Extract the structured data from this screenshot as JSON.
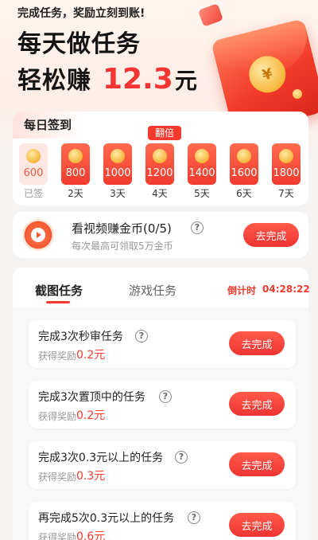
{
  "hero": {
    "subtitle": "完成任务，奖励立刻到账!",
    "line1": "每天做任务",
    "line2_prefix": "轻松赚",
    "amount": "12.3",
    "unit": "元",
    "seal_glyph": "¥"
  },
  "checkin": {
    "title": "每日签到",
    "double_badge": "翻倍",
    "days": [
      {
        "value": "600",
        "label": "已签",
        "done": true
      },
      {
        "value": "800",
        "label": "2天",
        "done": false
      },
      {
        "value": "1000",
        "label": "3天",
        "done": false
      },
      {
        "value": "1200",
        "label": "4天",
        "done": false
      },
      {
        "value": "1400",
        "label": "5天",
        "done": false
      },
      {
        "value": "1600",
        "label": "6天",
        "done": false
      },
      {
        "value": "1800",
        "label": "7天",
        "done": false
      }
    ]
  },
  "video": {
    "title": "看视频赚金币(0/5)",
    "subtitle": "每次最高可领取5万金币",
    "button": "去完成",
    "icon": "play-icon"
  },
  "tasks": {
    "tabs": [
      "截图任务",
      "游戏任务"
    ],
    "countdown_label": "倒计时",
    "countdown_value": "04:28:22",
    "reward_label": "获得奖励",
    "items": [
      {
        "name": "完成3次秒审任务",
        "reward": "0.2元",
        "button": "去完成"
      },
      {
        "name": "完成3次置顶中的任务",
        "reward": "0.2元",
        "button": "去完成"
      },
      {
        "name": "完成3次0.3元以上的任务",
        "reward": "0.3元",
        "button": "去完成"
      },
      {
        "name": "再完成5次0.3元以上的任务",
        "reward": "0.6元",
        "button": "去完成"
      }
    ]
  },
  "colors": {
    "accent": "#f23b2e",
    "background": "#f6f3f3"
  }
}
